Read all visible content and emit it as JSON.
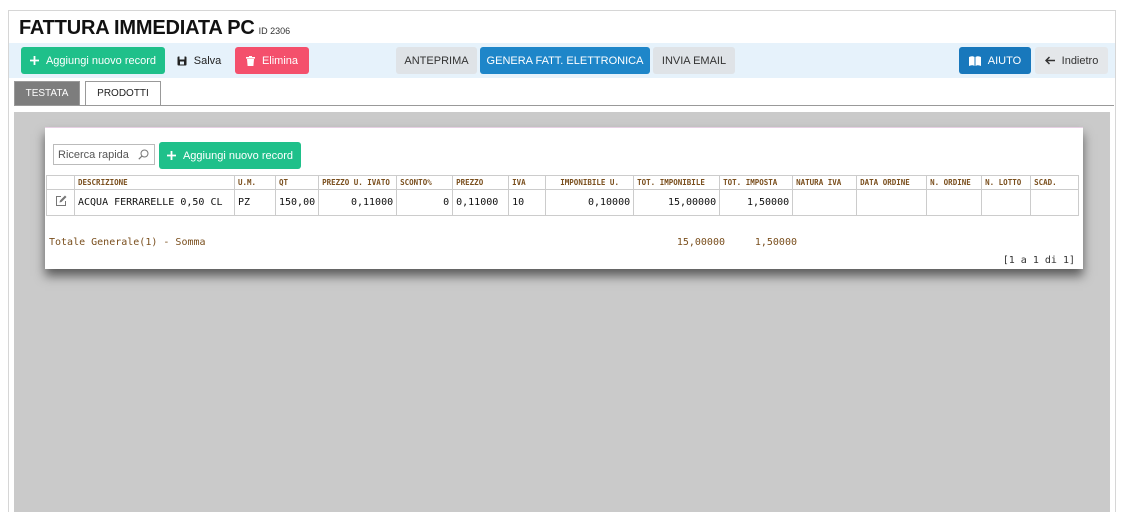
{
  "header": {
    "title": "FATTURA IMMEDIATA PC",
    "id_label": "ID 2306"
  },
  "toolbar": {
    "add_record": "Aggiungi nuovo record",
    "save": "Salva",
    "delete": "Elimina",
    "preview": "ANTEPRIMA",
    "generate_einvoice": "GENERA FATT. ELETTRONICA",
    "send_email": "INVIA EMAIL",
    "help": "AIUTO",
    "back": "Indietro"
  },
  "tabs": [
    {
      "label": "TESTATA",
      "active": false
    },
    {
      "label": "PRODOTTI",
      "active": true
    }
  ],
  "grid": {
    "search_placeholder": "Ricerca rapida",
    "add_record": "Aggiungi nuovo record",
    "columns": [
      "DESCRIZIONE",
      "U.M.",
      "QT",
      "PREZZO U. IVATO",
      "SCONTO%",
      "PREZZO",
      "IVA",
      "IMPONIBILE U.",
      "TOT. IMPONIBILE",
      "TOT. IMPOSTA",
      "NATURA IVA",
      "DATA ORDINE",
      "N. ORDINE",
      "N. LOTTO",
      "SCAD."
    ],
    "rows": [
      [
        "ACQUA FERRARELLE 0,50 CL",
        "PZ",
        "150,00",
        "0,11000",
        "0",
        "0,11000",
        "10",
        "0,10000",
        "15,00000",
        "1,50000",
        "",
        "",
        "",
        "",
        ""
      ]
    ],
    "total_label": "Totale Generale(1) - Somma",
    "total_imponibile": "15,00000",
    "total_imposta": "1,50000",
    "pager": "[1 a 1 di 1]"
  },
  "colors": {
    "green": "#1fc08a",
    "red": "#f4506c",
    "blue": "#1e86c9",
    "header_text": "#7a4f1e",
    "toolbar_bg": "#e6f2fb"
  }
}
